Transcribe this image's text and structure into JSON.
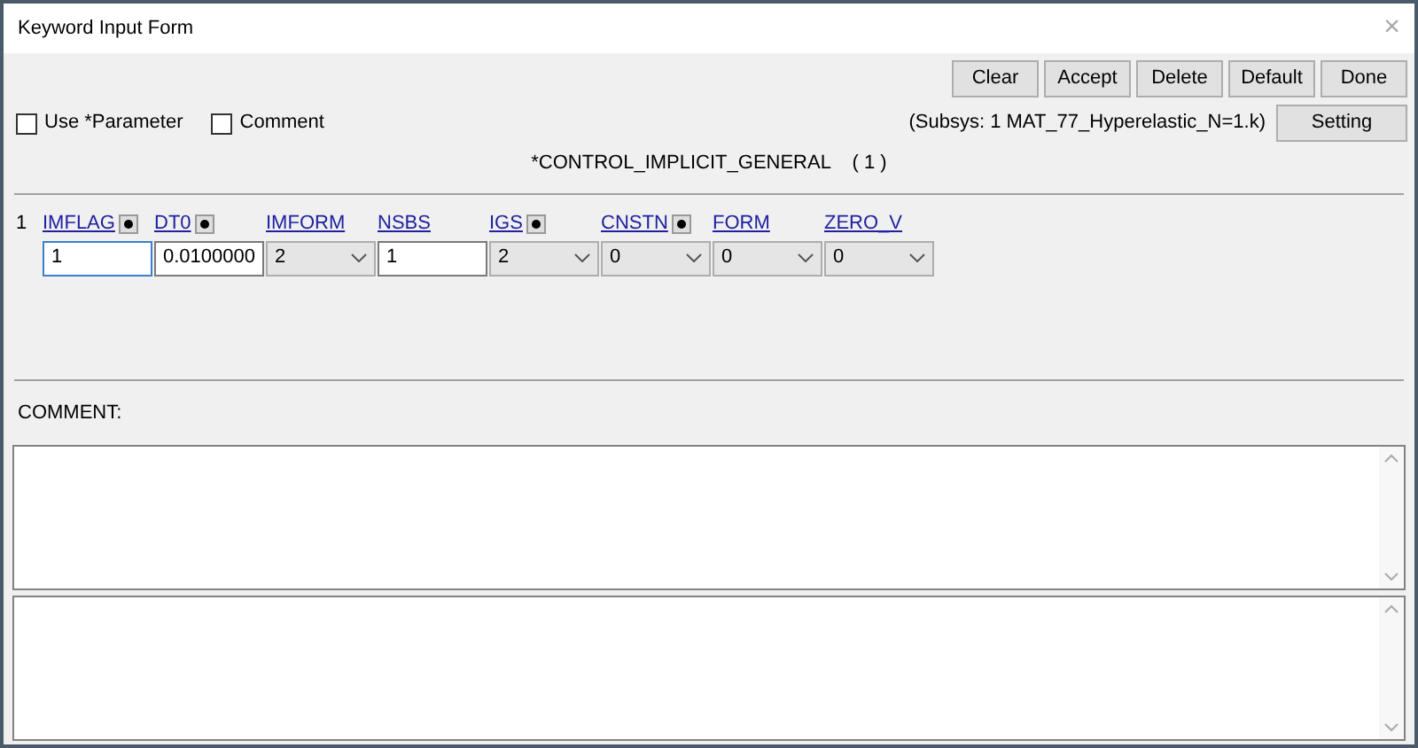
{
  "window": {
    "title": "Keyword Input Form",
    "close": "×"
  },
  "buttons": [
    "Clear",
    "Accept",
    "Delete",
    "Default",
    "Done"
  ],
  "options": [
    {
      "label": "Use *Parameter",
      "checked": false
    },
    {
      "label": "Comment",
      "checked": false
    }
  ],
  "subsys": "(Subsys: 1 MAT_77_Hyperelastic_N=1.k)",
  "setting_button": "Setting",
  "keyword_title": "*CONTROL_IMPLICIT_GENERAL    ( 1 )",
  "row_number": "1",
  "fields": [
    {
      "label": "IMFLAG",
      "dot": true,
      "kind": "text",
      "value": "1",
      "focused": true
    },
    {
      "label": "DT0",
      "dot": true,
      "kind": "text",
      "value": "0.0100000",
      "focused": false
    },
    {
      "label": "IMFORM",
      "dot": false,
      "kind": "select",
      "value": "2"
    },
    {
      "label": "NSBS",
      "dot": false,
      "kind": "text",
      "value": "1",
      "focused": false
    },
    {
      "label": "IGS",
      "dot": true,
      "kind": "select",
      "value": "2"
    },
    {
      "label": "CNSTN",
      "dot": true,
      "kind": "select",
      "value": "0"
    },
    {
      "label": "FORM",
      "dot": false,
      "kind": "select",
      "value": "0"
    },
    {
      "label": "ZERO_V",
      "dot": false,
      "kind": "select",
      "value": "0"
    }
  ],
  "comment_label": "COMMENT:"
}
